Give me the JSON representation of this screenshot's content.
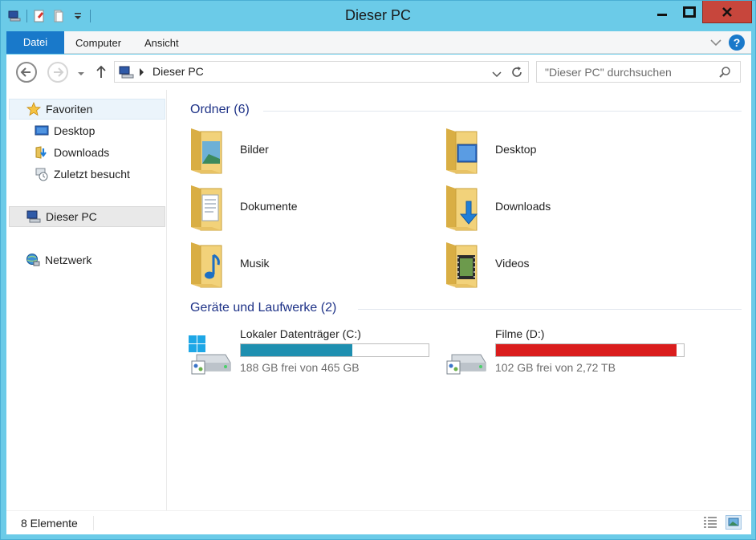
{
  "window": {
    "title": "Dieser PC",
    "accent": "#6bcbe8",
    "close_color": "#c7463c"
  },
  "qat": {
    "icons": [
      "computer-icon",
      "properties-icon",
      "new-folder-icon",
      "customize-dropdown-icon"
    ]
  },
  "ribbon": {
    "tabs": [
      {
        "label": "Datei",
        "active": true,
        "color": "#1979ca"
      },
      {
        "label": "Computer"
      },
      {
        "label": "Ansicht"
      }
    ],
    "help": "?"
  },
  "navigation": {
    "breadcrumb": "Dieser PC",
    "search_placeholder": "\"Dieser PC\" durchsuchen"
  },
  "sidebar": {
    "favorites_label": "Favoriten",
    "favorites": [
      {
        "label": "Desktop",
        "icon": "desktop-icon"
      },
      {
        "label": "Downloads",
        "icon": "downloads-icon"
      },
      {
        "label": "Zuletzt besucht",
        "icon": "recent-places-icon"
      }
    ],
    "this_pc": "Dieser PC",
    "network": "Netzwerk"
  },
  "folders_group": {
    "heading": "Ordner (6)",
    "items": [
      {
        "label": "Bilder",
        "icon": "pictures-folder-icon"
      },
      {
        "label": "Desktop",
        "icon": "desktop-folder-icon"
      },
      {
        "label": "Dokumente",
        "icon": "documents-folder-icon"
      },
      {
        "label": "Downloads",
        "icon": "downloads-folder-icon"
      },
      {
        "label": "Musik",
        "icon": "music-folder-icon"
      },
      {
        "label": "Videos",
        "icon": "videos-folder-icon"
      }
    ]
  },
  "drives_group": {
    "heading": "Geräte und Laufwerke (2)",
    "items": [
      {
        "name": "Lokaler Datenträger (C:)",
        "free": "188 GB frei von 465 GB",
        "used_fraction": 0.596,
        "bar_color": "#1e8fb0",
        "icon": "system-drive-icon"
      },
      {
        "name": "Filme (D:)",
        "free": "102 GB frei von 2,72 TB",
        "used_fraction": 0.963,
        "bar_color": "#da1d1d",
        "icon": "hard-drive-icon"
      }
    ]
  },
  "statusbar": {
    "count": "8 Elemente"
  }
}
